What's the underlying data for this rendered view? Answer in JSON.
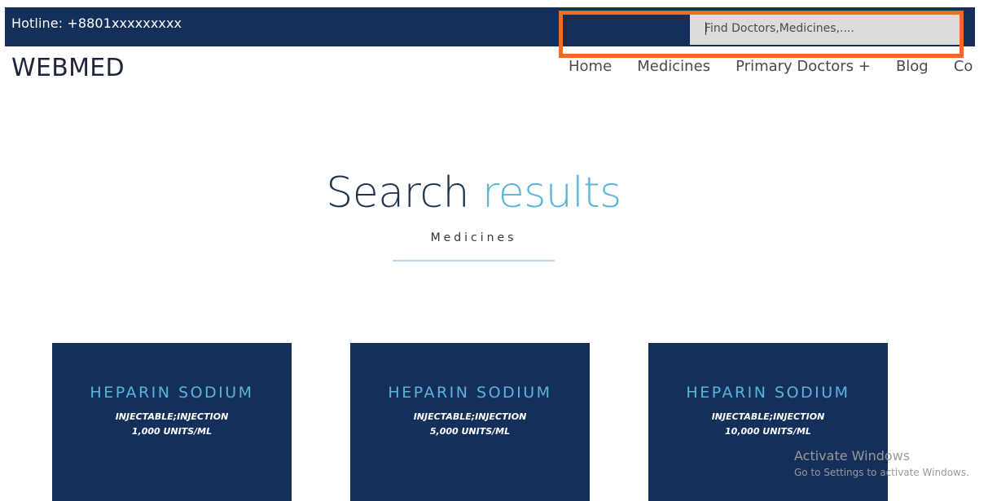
{
  "header": {
    "hotline": "Hotline: +8801xxxxxxxxx",
    "search_placeholder": "Find Doctors,Medicines,...."
  },
  "brand": {
    "logo": "WEBMED"
  },
  "nav": {
    "items": [
      "Home",
      "Medicines",
      "Primary Doctors +",
      "Blog",
      "Contact"
    ]
  },
  "main": {
    "title_part1": "Search",
    "title_part2": "results",
    "subtitle": "Medicines"
  },
  "results": [
    {
      "name": "HEPARIN SODIUM",
      "form": "INJECTABLE;INJECTION",
      "strength": "1,000 UNITS/ML"
    },
    {
      "name": "HEPARIN SODIUM",
      "form": "INJECTABLE;INJECTION",
      "strength": "5,000 UNITS/ML"
    },
    {
      "name": "HEPARIN SODIUM",
      "form": "INJECTABLE;INJECTION",
      "strength": "10,000 UNITS/ML"
    }
  ],
  "watermark": {
    "line1": "Activate Windows",
    "line2": "Go to Settings to activate Windows."
  },
  "colors": {
    "navy": "#14305a",
    "accent": "#5bb5d8",
    "highlight": "#f26b21"
  }
}
